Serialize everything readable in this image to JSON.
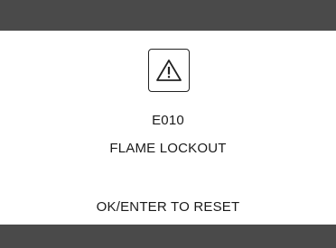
{
  "screen": {
    "error_code": "E010",
    "error_message": "FLAME LOCKOUT",
    "reset_instruction": "OK/ENTER TO RESET",
    "icon": "warning-triangle-icon"
  },
  "colors": {
    "bar": "#4a4a4a",
    "background": "#ffffff",
    "text": "#1a1a1a"
  }
}
